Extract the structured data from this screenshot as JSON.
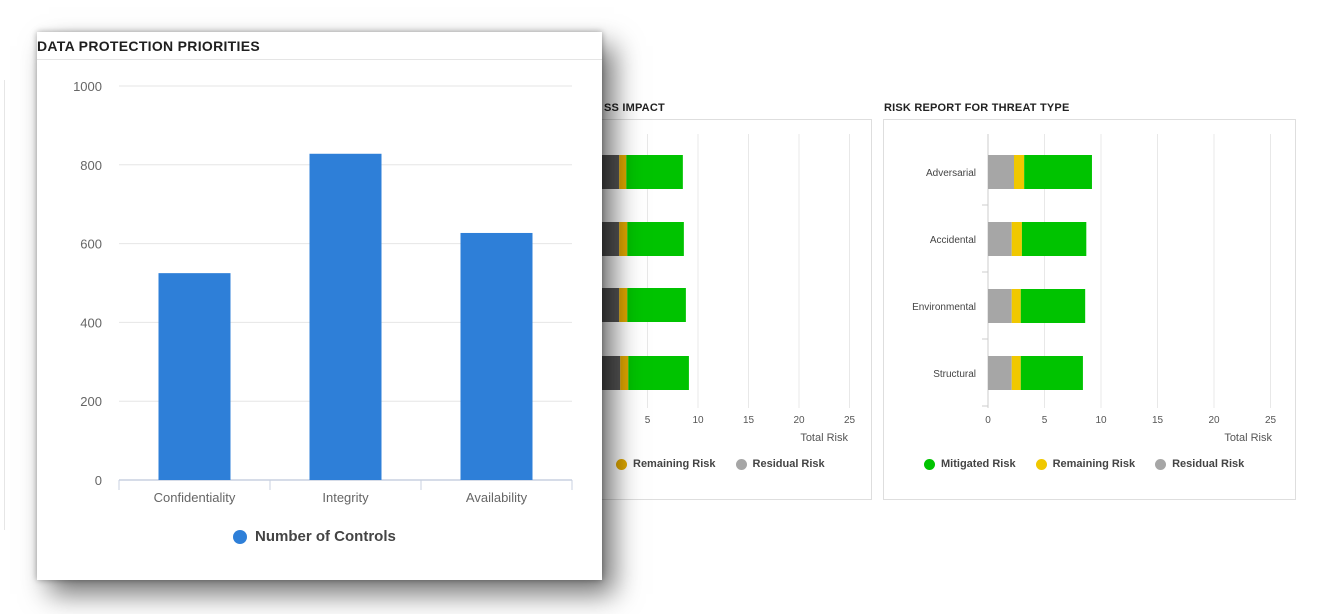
{
  "background_panels": [
    {
      "title": "SS IMPACT",
      "axis_title": "Total Risk",
      "ticks": [
        "5",
        "10",
        "15",
        "20",
        "25"
      ],
      "legend": [
        {
          "label": "Remaining Risk",
          "color": "#e0a800"
        },
        {
          "label": "Residual Risk",
          "color": "#a6a6a6"
        }
      ]
    },
    {
      "title": "RISK REPORT FOR THREAT TYPE",
      "axis_title": "Total Risk",
      "ticks": [
        "0",
        "5",
        "10",
        "15",
        "20",
        "25"
      ],
      "legend": [
        {
          "label": "Mitigated Risk",
          "color": "#00c300"
        },
        {
          "label": "Remaining Risk",
          "color": "#f0c800"
        },
        {
          "label": "Residual Risk",
          "color": "#a6a6a6"
        }
      ]
    }
  ],
  "foreground": {
    "title": "DATA PROTECTION PRIORITIES",
    "legend_label": "Number of Controls",
    "legend_color": "#2e7fd8"
  },
  "chart_data": [
    {
      "type": "bar",
      "title": "DATA PROTECTION PRIORITIES",
      "categories": [
        "Confidentiality",
        "Integrity",
        "Availability"
      ],
      "series": [
        {
          "name": "Number of Controls",
          "values": [
            525,
            828,
            627
          ],
          "color": "#2e7fd8"
        }
      ],
      "ylim": [
        0,
        1000
      ],
      "yticks": [
        "0",
        "200",
        "400",
        "600",
        "800",
        "1000"
      ],
      "grid": true,
      "legend_position": "bottom"
    },
    {
      "type": "bar",
      "orientation": "horizontal",
      "stacked": true,
      "title": "SS IMPACT",
      "xlabel": "Total Risk",
      "xlim": [
        0,
        26
      ],
      "series": [
        {
          "name": "Residual Risk",
          "values": [
            2.2,
            2.2,
            2.2,
            2.3
          ],
          "color": "#555555"
        },
        {
          "name": "Remaining Risk",
          "values": [
            0.7,
            0.8,
            0.8,
            0.8
          ],
          "color": "#e0a800"
        },
        {
          "name": "Mitigated Risk",
          "values": [
            5.6,
            5.6,
            5.8,
            6.0
          ],
          "color": "#00c300"
        }
      ],
      "grid": true,
      "legend_position": "bottom"
    },
    {
      "type": "bar",
      "orientation": "horizontal",
      "stacked": true,
      "title": "RISK REPORT FOR THREAT TYPE",
      "categories": [
        "Adversarial",
        "Accidental",
        "Environmental",
        "Structural"
      ],
      "xlabel": "Total Risk",
      "xlim": [
        0,
        26
      ],
      "series": [
        {
          "name": "Residual Risk",
          "values": [
            2.3,
            2.1,
            2.1,
            2.1
          ],
          "color": "#a6a6a6"
        },
        {
          "name": "Remaining Risk",
          "values": [
            0.9,
            0.9,
            0.8,
            0.8
          ],
          "color": "#f0c800"
        },
        {
          "name": "Mitigated Risk",
          "values": [
            6.0,
            5.7,
            5.7,
            5.5
          ],
          "color": "#00c300"
        }
      ],
      "grid": true,
      "legend_position": "bottom"
    }
  ]
}
